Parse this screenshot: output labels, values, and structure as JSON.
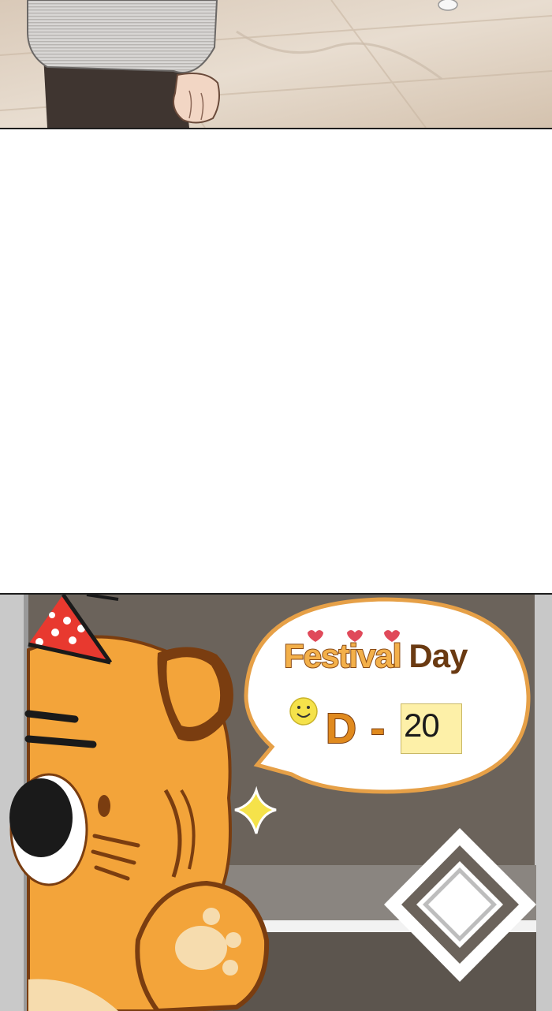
{
  "speech_bubble": {
    "festival": "Festival",
    "day": "Day",
    "d_letter": "D",
    "dash": "-",
    "countdown": "20"
  },
  "colors": {
    "border": "#1d1d1d",
    "tiger_orange": "#f3a43a",
    "tiger_outline": "#7a3d10",
    "wall": "#6b635b",
    "note": "#fdf0a8",
    "party_hat": "#e8392f"
  },
  "icons": [
    "heart-icon",
    "smiley-icon",
    "sparkle-icon",
    "diamond-logo"
  ]
}
